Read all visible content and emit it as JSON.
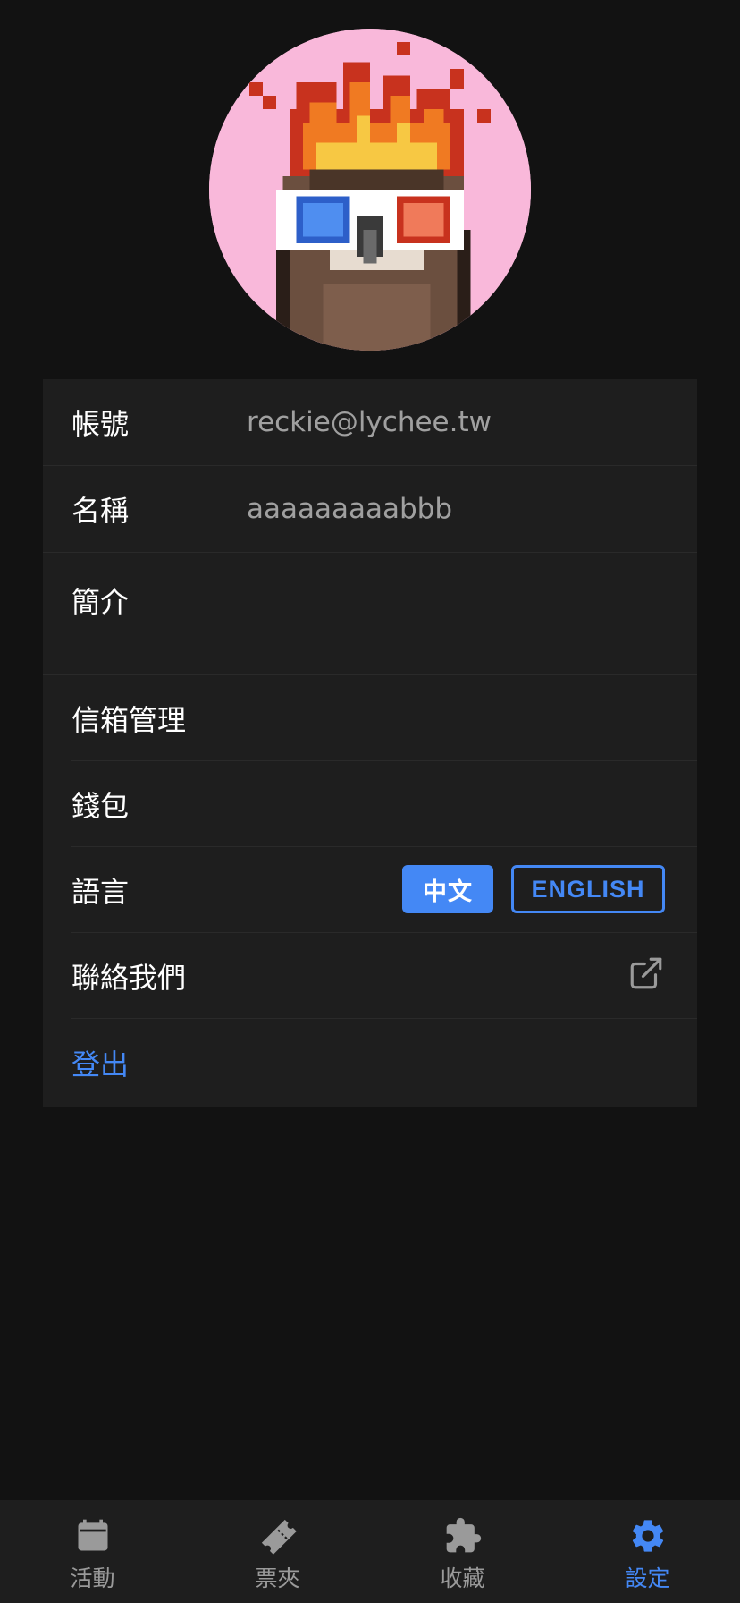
{
  "profile": {
    "avatar_bg": "#f9b8da"
  },
  "account": {
    "account_label": "帳號",
    "account_value": "reckie@lychee.tw",
    "name_label": "名稱",
    "name_value": "aaaaaaaaabbb",
    "bio_label": "簡介"
  },
  "settings": {
    "mailbox_label": "信箱管理",
    "wallet_label": "錢包",
    "language_label": "語言",
    "lang_zh": "中文",
    "lang_en": "ENGLISH",
    "contact_label": "聯絡我們",
    "logout_label": "登出"
  },
  "tabbar": {
    "tabs": [
      {
        "label": "活動",
        "icon": "calendar-icon"
      },
      {
        "label": "票夾",
        "icon": "ticket-icon"
      },
      {
        "label": "收藏",
        "icon": "puzzle-icon"
      },
      {
        "label": "設定",
        "icon": "gear-icon"
      }
    ],
    "active": "設定"
  },
  "colors": {
    "accent": "#4488f5",
    "background": "#121212",
    "card": "#1e1e1e"
  }
}
